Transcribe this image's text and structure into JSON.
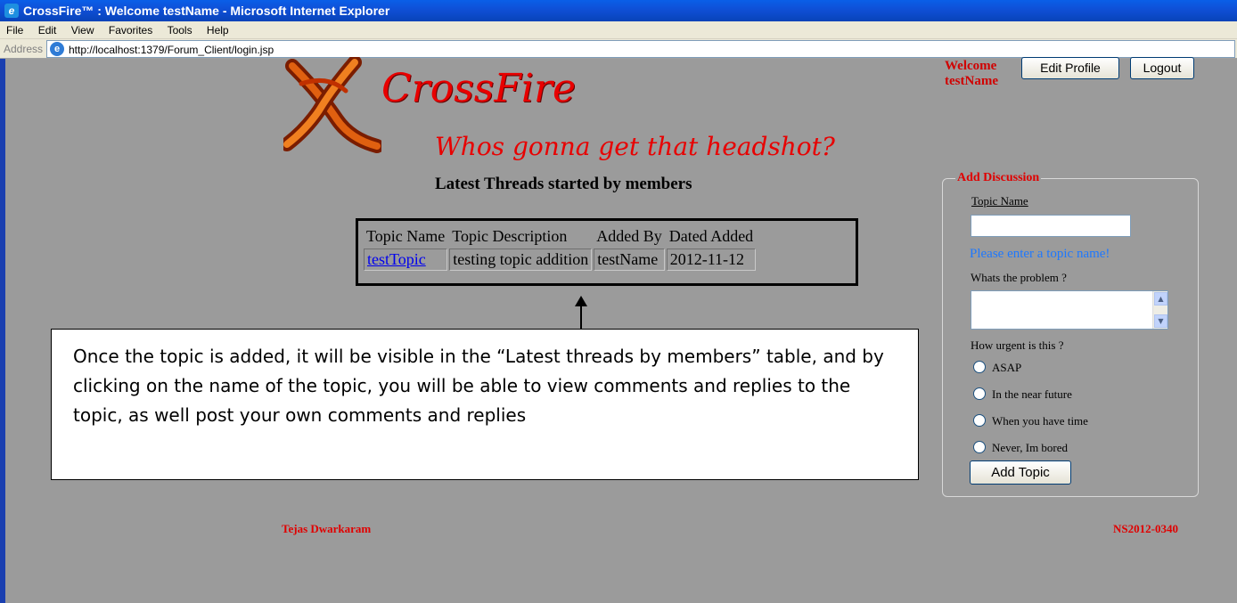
{
  "window": {
    "title": "CrossFire™ : Welcome testName - Microsoft Internet Explorer",
    "menu": [
      "File",
      "Edit",
      "View",
      "Favorites",
      "Tools",
      "Help"
    ],
    "address_label": "Address",
    "url": "http://localhost:1379/Forum_Client/login.jsp"
  },
  "header": {
    "logo_title": "CrossFire",
    "tagline": "Whos gonna get that headshot?",
    "welcome_text": "Welcome testName",
    "edit_profile_label": "Edit Profile",
    "logout_label": "Logout"
  },
  "threads": {
    "heading": "Latest Threads started by members",
    "columns": [
      "Topic Name",
      "Topic Description",
      "Added By",
      "Dated Added"
    ],
    "rows": [
      {
        "topic": "testTopic",
        "description": "testing topic addition",
        "added_by": "testName",
        "date": "2012-11-12"
      }
    ]
  },
  "callout": {
    "text": "Once the topic is added, it will be visible in the “Latest threads by members” table, and by clicking on the name of the topic, you will be able to view comments and replies to the topic, as well post your own comments and replies"
  },
  "add_discussion": {
    "legend": "Add Discussion",
    "topic_label": "Topic Name",
    "topic_value": "",
    "topic_error": "Please enter a topic name!",
    "problem_label": "Whats the problem ?",
    "problem_value": "",
    "urgency_label": "How urgent is this ?",
    "urgency_options": [
      "ASAP",
      "In the near future",
      "When you have time",
      "Never, Im bored"
    ],
    "submit_label": "Add Topic"
  },
  "footer": {
    "left": "Tejas Dwarkaram",
    "right": "NS2012-0340"
  },
  "colors": {
    "page_bg": "#9b9b9b",
    "accent_red": "#e00000",
    "link_blue": "#0000ee",
    "error_blue": "#1e78ff"
  }
}
